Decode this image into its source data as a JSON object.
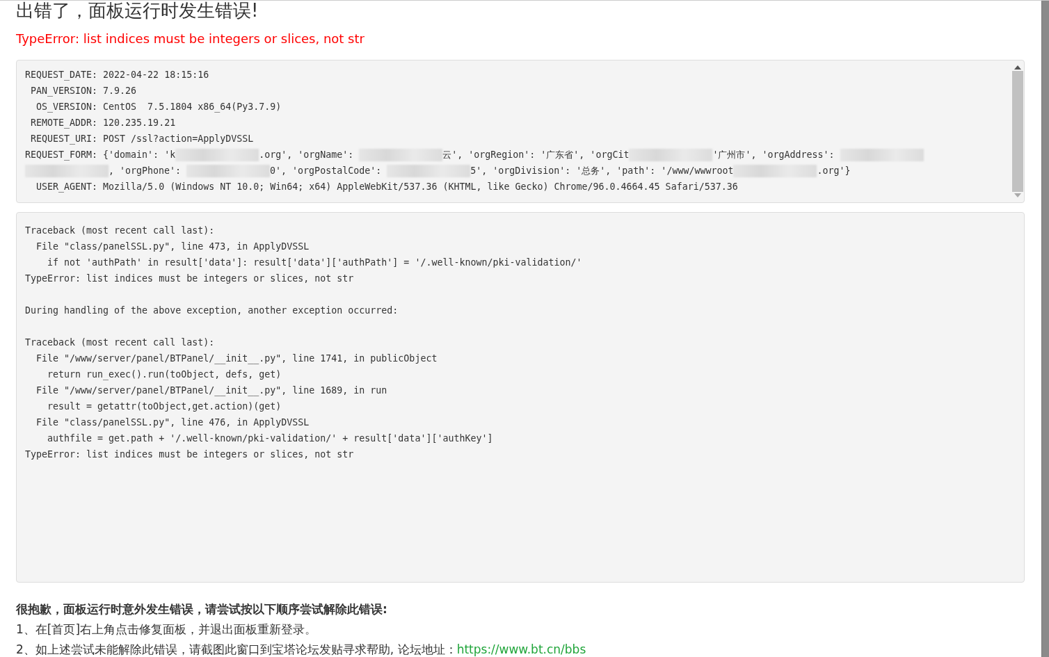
{
  "title": "出错了，面板运行时发生错误!",
  "error_message": "TypeError: list indices must be integers or slices, not str",
  "request_info": {
    "lines_before": [
      "REQUEST_DATE: 2022-04-22 18:15:16",
      " PAN_VERSION: 7.9.26",
      "  OS_VERSION: CentOS  7.5.1804 x86_64(Py3.7.9)",
      " REMOTE_ADDR: 120.235.19.21",
      " REQUEST_URI: POST /ssl?action=ApplyDVSSL"
    ],
    "request_form": [
      [
        {
          "kind": "text",
          "text": "REQUEST_FORM: {'domain': 'k"
        },
        {
          "kind": "redacted"
        },
        {
          "kind": "text",
          "text": ".org', 'orgName': "
        },
        {
          "kind": "redacted"
        },
        {
          "kind": "text",
          "text": "云', 'orgRegion': '广东省', 'orgCit"
        },
        {
          "kind": "redacted"
        },
        {
          "kind": "text",
          "text": "'广州市', 'orgAddress': "
        },
        {
          "kind": "redacted"
        }
      ],
      [
        {
          "kind": "redacted"
        },
        {
          "kind": "text",
          "text": ", 'orgPhone': "
        },
        {
          "kind": "redacted"
        },
        {
          "kind": "text",
          "text": "0', 'orgPostalCode': "
        },
        {
          "kind": "redacted"
        },
        {
          "kind": "text",
          "text": "5', 'orgDivision': '总务', 'path': '/www/wwwroot"
        },
        {
          "kind": "redacted"
        },
        {
          "kind": "text",
          "text": ".org'}"
        }
      ]
    ],
    "lines_after": [
      "  USER_AGENT: Mozilla/5.0 (Windows NT 10.0; Win64; x64) AppleWebKit/537.36 (KHTML, like Gecko) Chrome/96.0.4664.45 Safari/537.36"
    ]
  },
  "traceback": "Traceback (most recent call last):\n  File \"class/panelSSL.py\", line 473, in ApplyDVSSL\n    if not 'authPath' in result['data']: result['data']['authPath'] = '/.well-known/pki-validation/'\nTypeError: list indices must be integers or slices, not str\n\nDuring handling of the above exception, another exception occurred:\n\nTraceback (most recent call last):\n  File \"/www/server/panel/BTPanel/__init__.py\", line 1741, in publicObject\n    return run_exec().run(toObject, defs, get)\n  File \"/www/server/panel/BTPanel/__init__.py\", line 1689, in run\n    result = getattr(toObject,get.action)(get)\n  File \"class/panelSSL.py\", line 476, in ApplyDVSSL\n    authfile = get.path + '/.well-known/pki-validation/' + result['data']['authKey']\nTypeError: list indices must be integers or slices, not str",
  "help": {
    "heading": "很抱歉，面板运行时意外发生错误，请尝试按以下顺序尝试解除此错误:",
    "steps": [
      {
        "text": "1、在[首页]右上角点击修复面板，并退出面板重新登录。"
      },
      {
        "text": "2、如上述尝试未能解除此错误，请截图此窗口到宝塔论坛发贴寻求帮助, 论坛地址：",
        "link": "https://www.bt.cn/bbs"
      }
    ]
  }
}
